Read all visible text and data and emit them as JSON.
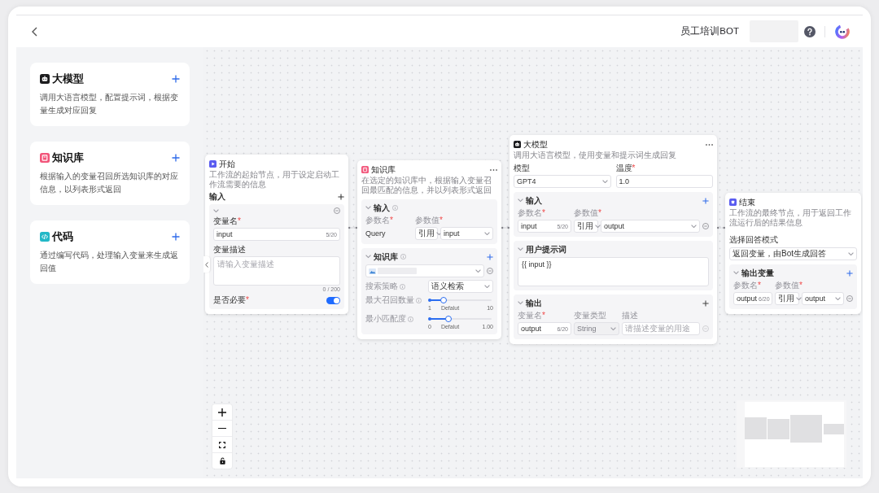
{
  "header": {
    "title": "员工培训BOT"
  },
  "node_panel": {
    "items": [
      {
        "kind": "llm",
        "title": "大模型",
        "description": "调用大语言模型，配置提示词，根据变量生成对应回复"
      },
      {
        "kind": "knowledge",
        "title": "知识库",
        "description": "根据输入的变量召回所选知识库的对应信息，以列表形式返回"
      },
      {
        "kind": "code",
        "title": "代码",
        "description": "通过编写代码，处理输入变量来生成返回值"
      }
    ]
  },
  "canvas": {
    "nodes": [
      {
        "kind": "start",
        "title": "开始",
        "description": "工作流的起始节点，用于设定启动工作流需要的信息",
        "input_label": "输入",
        "variable": {
          "expanded": true,
          "name_label": {
            "text": "变量名",
            "mark": "*"
          },
          "name_value": "input",
          "name_count": "5/20",
          "desc_label": "变量描述",
          "desc_placeholder": "请输入变量描述",
          "desc_count": "0 / 200",
          "required_label": {
            "text": "是否必要",
            "mark": "*"
          },
          "required": true
        }
      },
      {
        "kind": "knowledge",
        "title": "知识库",
        "description": "在选定的知识库中，根据输入变量召回最匹配的信息，并以列表形式返回",
        "input_section": {
          "title": "输入",
          "expanded": true,
          "param_label": {
            "text": "参数名",
            "mark": "*"
          },
          "value_label": {
            "text": "参数值",
            "mark": "*"
          },
          "param": "Query",
          "source": "引用",
          "value": "input"
        },
        "kb_section": {
          "title": "知识库",
          "expanded": true,
          "strategy_label": "搜索策略",
          "strategy": "语义检索",
          "sliders": [
            {
              "label": "最大召回数量",
              "level": 0.23,
              "min": "1",
              "default": "Defalut",
              "max": "10"
            },
            {
              "label": "最小匹配度",
              "level": 0.3,
              "min": "0",
              "default": "Defalut",
              "max": "1.00"
            }
          ]
        }
      },
      {
        "kind": "llm",
        "title": "大模型",
        "description": "调用大语言模型，使用变量和提示词生成回复",
        "model_label": "模型",
        "model": "GPT4",
        "temperature_label": {
          "text": "温度",
          "mark": "*"
        },
        "temperature": "1.0",
        "input_section": {
          "title": "输入",
          "expanded": true,
          "param_label": {
            "text": "参数名",
            "mark": "*"
          },
          "value_label": {
            "text": "参数值",
            "mark": "*"
          },
          "rows": [
            {
              "name": "input",
              "count": "5/20",
              "source": "引用",
              "value": "output"
            }
          ]
        },
        "prompt_section": {
          "title": "用户提示词",
          "expanded": true,
          "text": "{{ input }}"
        },
        "output_section": {
          "title": "输出",
          "expanded": true,
          "name_label": {
            "text": "变量名",
            "mark": "*"
          },
          "type_label": "变量类型",
          "desc_label": "描述",
          "rows": [
            {
              "name": "output",
              "count": "6/20",
              "type": "String",
              "desc_placeholder": "请描述变量的用途",
              "disabled": true
            }
          ]
        }
      },
      {
        "kind": "end",
        "title": "结束",
        "description": "工作流的最终节点，用于返回工作流运行后的结果信息",
        "mode_label": "选择回答模式",
        "mode": "返回变量，由Bot生成回答",
        "output_section": {
          "title": "输出变量",
          "expanded": true,
          "param_label": {
            "text": "参数名",
            "mark": "*"
          },
          "value_label": {
            "text": "参数值",
            "mark": "*"
          },
          "rows": [
            {
              "name": "output",
              "count": "6/20",
              "source": "引用",
              "value": "output"
            }
          ]
        }
      }
    ]
  }
}
